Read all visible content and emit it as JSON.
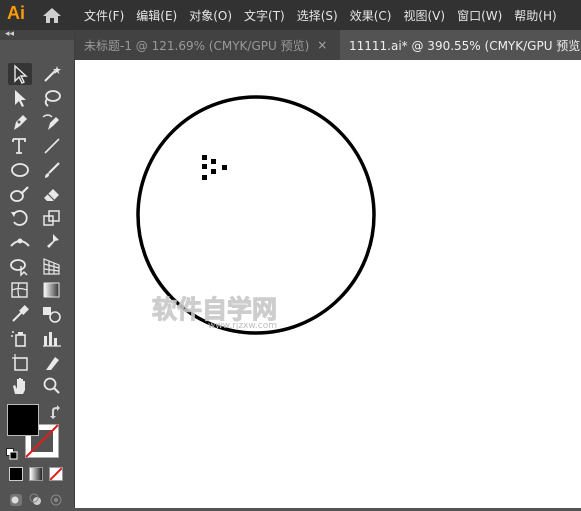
{
  "app": {
    "logo": "Ai"
  },
  "menu": [
    "文件(F)",
    "编辑(E)",
    "对象(O)",
    "文字(T)",
    "选择(S)",
    "效果(C)",
    "视图(V)",
    "窗口(W)",
    "帮助(H)"
  ],
  "panel": {
    "collapse": "◂◂"
  },
  "tabs": [
    {
      "label": "未标题-1 @ 121.69% (CMYK/GPU 预览)",
      "close": "×"
    },
    {
      "label": "11111.ai* @ 390.55% (CMYK/GPU 预览)"
    }
  ],
  "watermark": {
    "title": "软件自学网",
    "url": "www.rjzxw.com"
  },
  "colors": {
    "accent": "#FF9A00",
    "fill": "#000000",
    "stroke_none": "#E01B1B"
  },
  "tools": [
    "selection-tool",
    "direct-selection-tool",
    "magic-wand-tool",
    "lasso-tool",
    "pen-tool",
    "curvature-tool",
    "type-tool",
    "line-tool",
    "ellipse-tool",
    "paintbrush-tool",
    "shaper-tool",
    "eraser-tool",
    "rotate-tool",
    "scale-tool",
    "width-tool",
    "puppet-warp-tool",
    "shape-builder-tool",
    "perspective-grid-tool",
    "mesh-tool",
    "gradient-tool",
    "eyedropper-tool",
    "blend-tool",
    "symbol-sprayer-tool",
    "column-graph-tool",
    "artboard-tool",
    "slice-tool",
    "hand-tool",
    "zoom-tool"
  ]
}
